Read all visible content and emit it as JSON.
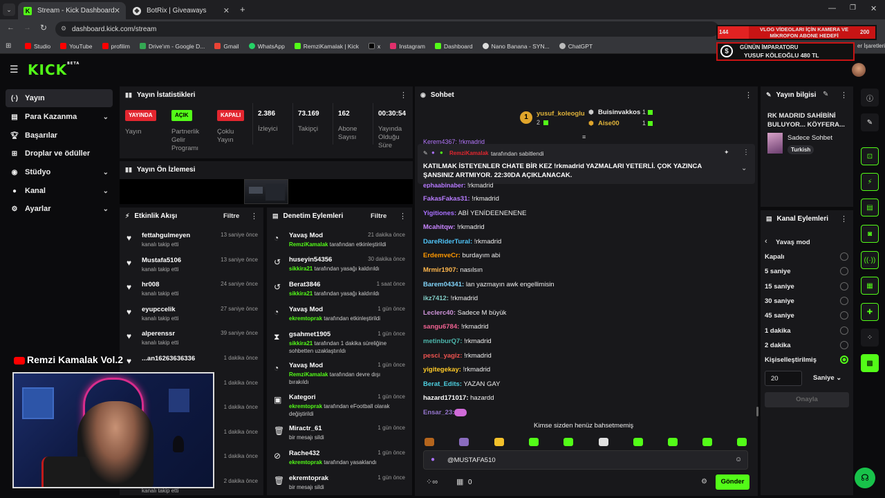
{
  "browser": {
    "tabs": [
      {
        "title": "Stream - Kick Dashboard",
        "active": true
      },
      {
        "title": "BotRix | Giveaways",
        "active": false
      }
    ],
    "url": "dashboard.kick.com/stream",
    "bookmarks": [
      "Studio",
      "YouTube",
      "profilim",
      "Drive'ım - Google D...",
      "Gmail",
      "WhatsApp",
      "RemziKamalak | Kick",
      "x",
      "Instagram",
      "Dashboard",
      "Nano Banana - SYN...",
      "ChatGPT"
    ],
    "bookmarks_right": "er İşaretleri"
  },
  "overlay": {
    "count_left": "144",
    "goal_text": "VLOG VİDEOLARI İÇİN KAMERA VE MİKROFON ABONE HEDEFİ",
    "count_right": "200",
    "emperor_title": "GÜNÜN İMPARATORU",
    "emperor_text": "YUSUF KÖLEOĞLU 480 TL"
  },
  "app": {
    "logo": "KICK",
    "logo_badge": "BETA"
  },
  "sidebar": {
    "items": [
      {
        "label": "Yayın",
        "icon": "broadcast-icon",
        "chev": false
      },
      {
        "label": "Para Kazanma",
        "icon": "money-icon",
        "chev": true
      },
      {
        "label": "Başarılar",
        "icon": "trophy-icon",
        "chev": false
      },
      {
        "label": "Droplar ve ödüller",
        "icon": "gift-icon",
        "chev": false
      },
      {
        "label": "Stüdyo",
        "icon": "globe-icon",
        "chev": true
      },
      {
        "label": "Kanal",
        "icon": "user-icon",
        "chev": true
      },
      {
        "label": "Ayarlar",
        "icon": "gear-icon",
        "chev": true
      }
    ]
  },
  "stats": {
    "title": "Yayın İstatistikleri",
    "items": [
      {
        "value": "YAYINDA",
        "label": "Yayın",
        "badge_color": "#e3262f"
      },
      {
        "value": "AÇIK",
        "label": "Partnerlik Gelir Programı",
        "badge_color": "#53fc18"
      },
      {
        "value": "KAPALI",
        "label": "Çoklu Yayın",
        "badge_color": "#e3262f"
      },
      {
        "value": "2.386",
        "label": "İzleyici"
      },
      {
        "value": "73.169",
        "label": "Takipçi"
      },
      {
        "value": "162",
        "label": "Abone Sayısı"
      },
      {
        "value": "00:30:54",
        "label": "Yayında Olduğu Süre"
      }
    ]
  },
  "preview": {
    "title": "Yayın Ön İzlemesi"
  },
  "activity": {
    "title": "Etkinlik Akışı",
    "filter": "Filtre",
    "rows": [
      {
        "name": "fettahgulmeyen",
        "action": "kanalı takip etti",
        "time": "13 saniye önce"
      },
      {
        "name": "Mustafa5106",
        "action": "kanalı takip etti",
        "time": "13 saniye önce"
      },
      {
        "name": "hr008",
        "action": "kanalı takip etti",
        "time": "24 saniye önce"
      },
      {
        "name": "eyupccelik",
        "action": "kanalı takip etti",
        "time": "27 saniye önce"
      },
      {
        "name": "alperenssr",
        "action": "kanalı takip etti",
        "time": "39 saniye önce"
      },
      {
        "name": "...an16263636336",
        "action": "",
        "time": "1 dakika önce"
      },
      {
        "name": "",
        "action": "",
        "time": "1 dakika önce"
      },
      {
        "name": "",
        "action": "",
        "time": "1 dakika önce"
      },
      {
        "name": "",
        "action": "",
        "time": "1 dakika önce"
      },
      {
        "name": "",
        "action": "",
        "time": "1 dakika önce"
      },
      {
        "name": "",
        "action": "kanalı takip etti",
        "time": "2 dakika önce"
      }
    ]
  },
  "moderation": {
    "title": "Denetim Eylemleri",
    "filter": "Filtre",
    "rows": [
      {
        "icon": "slow-mode-icon",
        "name": "Yavaş Mod",
        "actor": "RemziKamalak",
        "action": "tarafından etkinleştirildi",
        "time": "21 dakika önce"
      },
      {
        "icon": "undo-icon",
        "name": "huseyin54356",
        "actor": "sikkira21",
        "action": "tarafından yasağı kaldırıldı",
        "time": "30 dakika önce"
      },
      {
        "icon": "undo-icon",
        "name": "Berat3846",
        "actor": "sikkira21",
        "action": "tarafından yasağı kaldırıldı",
        "time": "1 saat önce"
      },
      {
        "icon": "slow-mode-icon",
        "name": "Yavaş Mod",
        "actor": "ekremtoprak",
        "action": "tarafından etkinleştirildi",
        "time": "1 gün önce"
      },
      {
        "icon": "hourglass-icon",
        "name": "gsahmet1905",
        "actor": "sikkira21",
        "action": "tarafından 1 dakika süreliğine sohbetten uzaklaştırıldı",
        "time": "1 gün önce"
      },
      {
        "icon": "slow-mode-icon",
        "name": "Yavaş Mod",
        "actor": "RemziKamalak",
        "action": "tarafından devre dışı bırakıldı",
        "time": "1 gün önce"
      },
      {
        "icon": "category-icon",
        "name": "Kategori",
        "actor": "ekremtoprak",
        "action": "tarafından eFootball olarak değiştirildi",
        "time": "1 gün önce"
      },
      {
        "icon": "trash-icon",
        "name": "Miractr_61",
        "actor": "",
        "action": "bir mesajı sildi",
        "time": "1 gün önce"
      },
      {
        "icon": "ban-icon",
        "name": "Rache432",
        "actor": "ekremtoprak",
        "action": "tarafından yasaklandı",
        "time": "1 gün önce"
      },
      {
        "icon": "trash-icon",
        "name": "ekremtoprak",
        "actor": "",
        "action": "bir mesajı sildi",
        "time": "1 gün önce"
      }
    ]
  },
  "chat": {
    "title": "Sohbet",
    "top_gifters": [
      {
        "rank": "1",
        "name": "yusuf_koleoglu",
        "count": "2"
      },
      {
        "name": "Buisinvakkos",
        "count": "1"
      },
      {
        "name": "Aise00",
        "count": "1"
      }
    ],
    "pinned": {
      "by": "RemziKamalak",
      "by_suffix": "tarafından sabitlendi",
      "message": "KATILMAK İSTEYENLER CHATE BİR KEZ !rkmadrid YAZMALARI YETERLİ. ÇOK YAZINCA ŞANSINIZ ARTMIYOR. 22:30DA AÇIKLANACAK."
    },
    "messages": [
      {
        "user": "FakasFakas31",
        "text": "!rkmadrid",
        "color": "#b77bff"
      },
      {
        "user": "Yigitiones",
        "text": "ABİ YENİDEENENENE",
        "color": "#a970ff"
      },
      {
        "user": "Mcahitqw",
        "text": "!rkmadrid",
        "color": "#c885ff"
      },
      {
        "user": "DareRiderTural",
        "text": "!rkmadrid",
        "color": "#4fc3f7"
      },
      {
        "user": "ErdemveCr",
        "text": "burdayım abi",
        "color": "#ff9800"
      },
      {
        "user": "Mrmir1907",
        "text": "nasılsın",
        "color": "#ffb74d"
      },
      {
        "user": "Barem04341",
        "text": "lan yazmayın awk engellimisin",
        "color": "#81d4fa"
      },
      {
        "user": "ikz7412",
        "text": "!rkmadrid",
        "color": "#80cbc4"
      },
      {
        "user": "Leclerc40",
        "text": "Sadece M büyük",
        "color": "#ce93d8"
      },
      {
        "user": "sangu6784",
        "text": "!rkmadrid",
        "color": "#f06292"
      },
      {
        "user": "metinburQ7",
        "text": "!rkmadrid",
        "color": "#4db6ac"
      },
      {
        "user": "pesci_yagiz",
        "text": "!rkmadrid",
        "color": "#ef5350"
      },
      {
        "user": "yigitegekay",
        "text": "!rkmadrid",
        "color": "#ffca28"
      },
      {
        "user": "Berat_Edits",
        "text": "YAZAN GAY",
        "color": "#4dd0e1"
      },
      {
        "user": "hazard171017",
        "text": "hazardd",
        "color": "#ffffff"
      },
      {
        "user": "Ensar_23",
        "text": "",
        "color": "#9575cd"
      }
    ],
    "mention_note": "Kimse sizden henüz bahsetmemiş",
    "input_value": "@MUSTAFA510",
    "points": "0",
    "send": "Gönder"
  },
  "stream_info": {
    "title": "Yayın bilgisi",
    "stream_title": "RK MADRID SAHİBİNİ BULUYOR... KÖYFERA...",
    "category": "Sadece Sohbet",
    "tag": "Turkish"
  },
  "channel_actions": {
    "title": "Kanal Eylemleri",
    "back_label": "Yavaş mod",
    "options": [
      "Kapalı",
      "5 saniye",
      "15 saniye",
      "30 saniye",
      "45 saniye",
      "1 dakika",
      "2 dakika",
      "Kişiselleştirilmiş"
    ],
    "selected_index": 7,
    "custom_value": "20",
    "unit": "Saniye",
    "apply": "Onayla"
  },
  "webcam": {
    "caption": "Remzi Kamalak Vol.2"
  },
  "colors": {
    "accent": "#53fc18",
    "panel": "#18181b",
    "bg": "#0b0b0d",
    "live": "#e3262f"
  }
}
